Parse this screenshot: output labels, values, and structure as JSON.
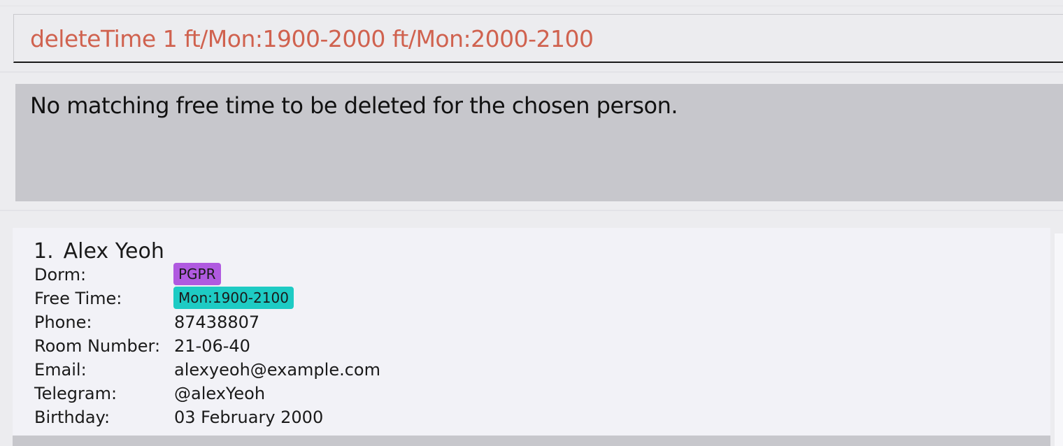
{
  "command": {
    "value": "deleteTime 1 ft/Mon:1900-2000 ft/Mon:2000-2100"
  },
  "result": {
    "message": "No matching free time to be deleted for the chosen person."
  },
  "person_list": [
    {
      "index": "1.",
      "name": "Alex Yeoh",
      "dorm_label": "Dorm:",
      "dorm_tag": "PGPR",
      "free_time_label": "Free Time:",
      "free_time_tag": "Mon:1900-2100",
      "phone_label": "Phone:",
      "phone": "87438807",
      "room_label": "Room Number:",
      "room": "21-06-40",
      "email_label": "Email:",
      "email": "alexyeoh@example.com",
      "telegram_label": "Telegram:",
      "telegram": "@alexYeoh",
      "birthday_label": "Birthday:",
      "birthday": "03 February 2000"
    }
  ],
  "colors": {
    "command_text": "#d0624f",
    "dorm_tag": "#b05ae0",
    "free_time_tag": "#1ecbc4",
    "result_bg": "#c7c7cc"
  }
}
